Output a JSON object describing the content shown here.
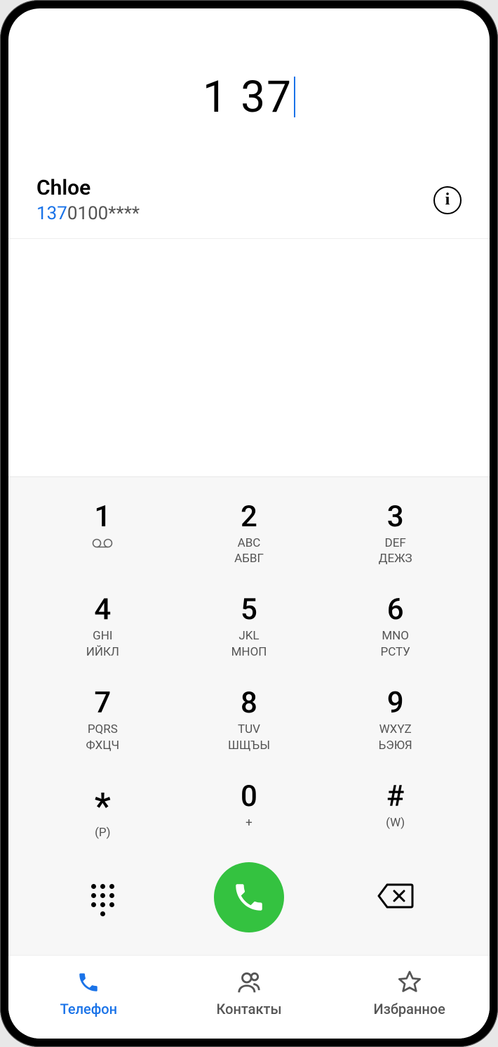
{
  "dialed_number": "1 37",
  "suggestion": {
    "name": "Chloe",
    "number_match": "137",
    "number_rest": "0100****"
  },
  "keys": {
    "k1": {
      "digit": "1",
      "sub1": "",
      "sub2": ""
    },
    "k2": {
      "digit": "2",
      "sub1": "ABC",
      "sub2": "АБВГ"
    },
    "k3": {
      "digit": "3",
      "sub1": "DEF",
      "sub2": "ДЕЖЗ"
    },
    "k4": {
      "digit": "4",
      "sub1": "GHI",
      "sub2": "ИЙКЛ"
    },
    "k5": {
      "digit": "5",
      "sub1": "JKL",
      "sub2": "МНОП"
    },
    "k6": {
      "digit": "6",
      "sub1": "MNO",
      "sub2": "РСТУ"
    },
    "k7": {
      "digit": "7",
      "sub1": "PQRS",
      "sub2": "ФХЦЧ"
    },
    "k8": {
      "digit": "8",
      "sub1": "TUV",
      "sub2": "ШЩЪЫ"
    },
    "k9": {
      "digit": "9",
      "sub1": "WXYZ",
      "sub2": "ЬЭЮЯ"
    },
    "kstar": {
      "digit": "*",
      "sub1": "(P)",
      "sub2": ""
    },
    "k0": {
      "digit": "0",
      "sub1": "+",
      "sub2": ""
    },
    "khash": {
      "digit": "#",
      "sub1": "(W)",
      "sub2": ""
    }
  },
  "tabs": {
    "phone": "Телефон",
    "contacts": "Контакты",
    "favorites": "Избранное"
  },
  "colors": {
    "accent": "#1a73e8",
    "call_green": "#34c240"
  }
}
